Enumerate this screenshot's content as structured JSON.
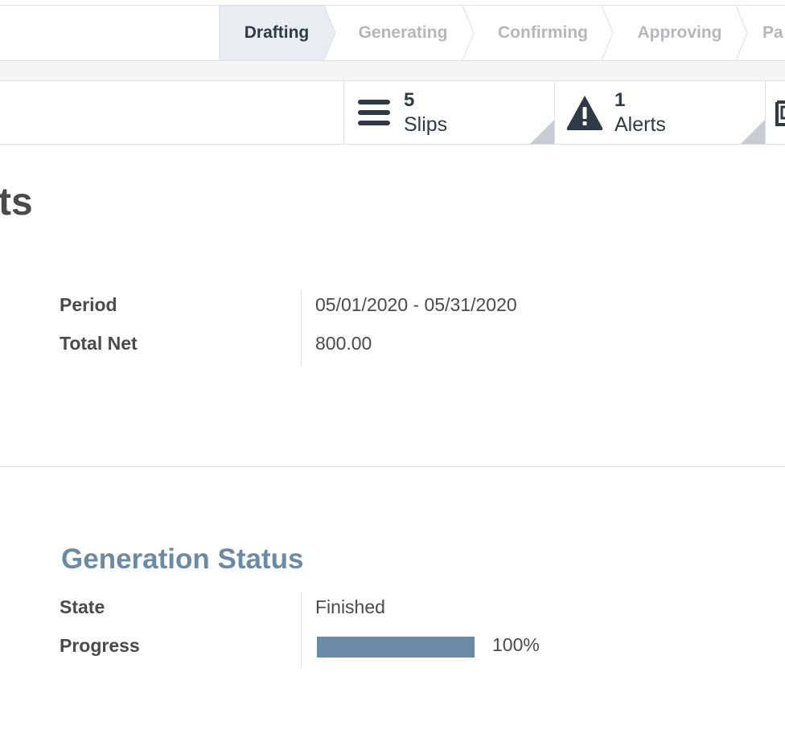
{
  "statusbar": {
    "stages": [
      {
        "label": "Drafting",
        "active": true
      },
      {
        "label": "Generating",
        "active": false
      },
      {
        "label": "Confirming",
        "active": false
      },
      {
        "label": "Approving",
        "active": false
      },
      {
        "label": "Pa",
        "active": false
      }
    ]
  },
  "smart_buttons": [
    {
      "icon": "list-icon",
      "value": "5",
      "label": "Slips"
    },
    {
      "icon": "warning-icon",
      "value": "1",
      "label": "Alerts"
    }
  ],
  "record": {
    "title": "ts"
  },
  "details": {
    "period_label": "Period",
    "period_value": "05/01/2020 - 05/31/2020",
    "total_net_label": "Total Net",
    "total_net_value": "800.00"
  },
  "generation": {
    "section_title": "Generation Status",
    "state_label": "State",
    "state_value": "Finished",
    "progress_label": "Progress",
    "progress_value": 100,
    "progress_text": "100%"
  },
  "colors": {
    "accent": "#6a8aa5",
    "active_stage_bg": "#e9ecf0",
    "text_dark": "#2e3a46"
  }
}
